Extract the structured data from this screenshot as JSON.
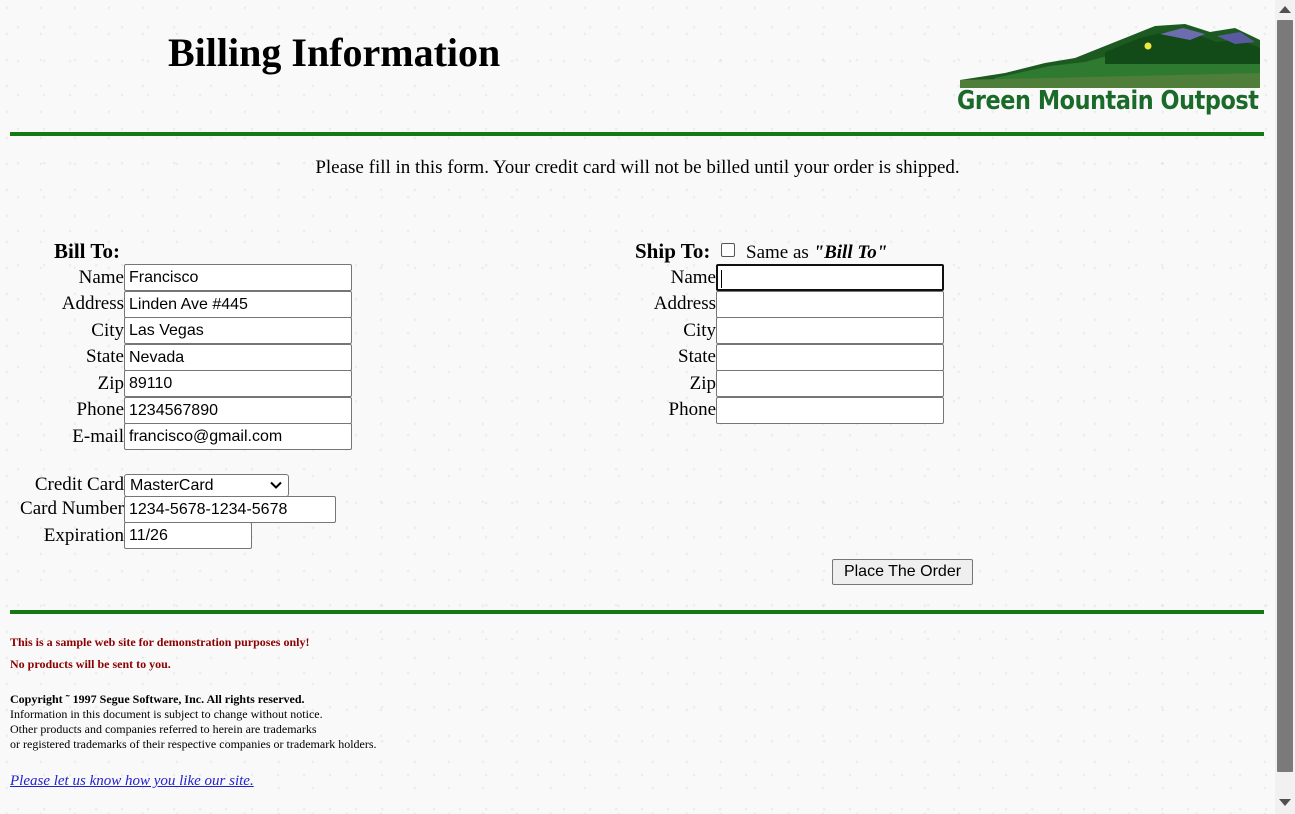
{
  "header": {
    "title": "Billing Information",
    "logo_text": "Green Mountain Outpost"
  },
  "intro": "Please fill in this form. Your credit card will not be billed until your order is shipped.",
  "bill_to": {
    "heading": "Bill To:",
    "fields": [
      {
        "label": "Name",
        "value": "Francisco"
      },
      {
        "label": "Address",
        "value": "Linden Ave #445"
      },
      {
        "label": "City",
        "value": "Las Vegas"
      },
      {
        "label": "State",
        "value": "Nevada"
      },
      {
        "label": "Zip",
        "value": "89110"
      },
      {
        "label": "Phone",
        "value": "1234567890"
      },
      {
        "label": "E-mail",
        "value": "francisco@gmail.com"
      }
    ]
  },
  "payment": {
    "credit_card_label": "Credit Card",
    "credit_card_value": "MasterCard",
    "card_number_label": "Card Number",
    "card_number_value": "1234-5678-1234-5678",
    "expiration_label": "Expiration",
    "expiration_value": "11/26"
  },
  "ship_to": {
    "heading": "Ship To:",
    "same_as_prefix": "Same as ",
    "same_as_bold": "\"Bill To\"",
    "same_as_checked": false,
    "fields": [
      {
        "label": "Name",
        "value": ""
      },
      {
        "label": "Address",
        "value": ""
      },
      {
        "label": "City",
        "value": ""
      },
      {
        "label": "State",
        "value": ""
      },
      {
        "label": "Zip",
        "value": ""
      },
      {
        "label": "Phone",
        "value": ""
      }
    ]
  },
  "place_order_label": "Place The Order",
  "footer": {
    "disclaimer_1": "This is a sample web site for demonstration purposes only!",
    "disclaimer_2": "No products will be sent to you.",
    "copyright": "Copyright ˜ 1997 Segue Software, Inc. All rights reserved.",
    "notice_1": "Information in this document is subject to change without notice.",
    "notice_2": "Other products and companies referred to herein are trademarks",
    "notice_3": "or registered trademarks of their respective companies or trademark holders.",
    "feedback_link": "Please let us know how you like our site."
  },
  "colors": {
    "rule": "#137a13",
    "disclaimer": "#8b0000",
    "link": "#2222cc",
    "logo_text": "#1a6a2a"
  },
  "icons": {
    "select_arrow": "chevron-down-icon",
    "scroll_up": "scroll-up-arrow-icon",
    "scroll_down": "scroll-down-arrow-icon"
  }
}
